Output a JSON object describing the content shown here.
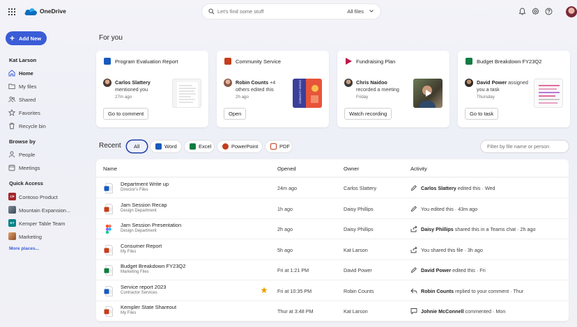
{
  "app": {
    "name": "OneDrive"
  },
  "search": {
    "placeholder": "Let's find some stuff",
    "filter": "All files"
  },
  "sidebar": {
    "new_label": "Add New",
    "user": "Kat Larson",
    "nav": [
      {
        "label": "Home",
        "icon": "home-icon",
        "active": true
      },
      {
        "label": "My files",
        "icon": "folder-icon"
      },
      {
        "label": "Shared",
        "icon": "people-icon"
      },
      {
        "label": "Favorites",
        "icon": "star-icon"
      },
      {
        "label": "Recycle bin",
        "icon": "trash-icon"
      }
    ],
    "browse_by": "Browse by",
    "browse": [
      {
        "label": "People",
        "icon": "person-icon"
      },
      {
        "label": "Meetings",
        "icon": "calendar-icon"
      }
    ],
    "quick_access": "Quick Access",
    "quick": [
      {
        "label": "Contoso Product",
        "badge": "CP",
        "color": "#a4262c"
      },
      {
        "label": "Mountain Expansion...",
        "badge": "",
        "color": "#6b6b6b"
      },
      {
        "label": "Kemper Table Team",
        "badge": "KT",
        "color": "#038387"
      },
      {
        "label": "Marketing",
        "badge": "",
        "color": "#c47a4a"
      }
    ],
    "more_places": "More places..."
  },
  "for_you": {
    "heading": "For you",
    "cards": [
      {
        "title": "Program Evaluation Report",
        "app": "word",
        "person": "Carlos Slattery",
        "action": "mentioned you",
        "time": "27m ago",
        "button": "Go to comment"
      },
      {
        "title": "Community Service",
        "app": "powerpoint",
        "person": "Robin Counts",
        "person_extra": " +4",
        "action": "others edited this",
        "time": "2h ago",
        "button": "Open",
        "thumb_text": "COMMUNITY SERVICE"
      },
      {
        "title": "Fundraising Plan",
        "app": "stream",
        "person": "Chris Naidoo",
        "action": "recorded a meeting",
        "time": "Friday",
        "button": "Watch recording"
      },
      {
        "title": "Budget Breakdown FY23Q2",
        "app": "excel",
        "person": "David Power",
        "action": "assigned you a task",
        "time": "Thursday",
        "button": "Go to task"
      }
    ]
  },
  "recent": {
    "heading": "Recent",
    "chips": [
      "All",
      "Word",
      "Excel",
      "PowerPoint",
      "PDF"
    ],
    "filter_placeholder": "Filter by file name or person",
    "columns": [
      "Name",
      "Opened",
      "Owner",
      "Activity"
    ],
    "rows": [
      {
        "name": "Department Write up",
        "location": "Director's Files",
        "type": "word",
        "opened": "24m ago",
        "owner": "Carlos Slattery",
        "activity_icon": "pencil-icon",
        "actor": "Carlos Slattery",
        "activity": " edited this · Wed",
        "starred": false
      },
      {
        "name": "Jam Session Recap",
        "location": "Design Department",
        "type": "powerpoint",
        "opened": "1h ago",
        "owner": "Daisy Phillips",
        "activity_icon": "pencil-icon",
        "actor": "",
        "activity": "You edited this · 43m ago",
        "starred": false
      },
      {
        "name": "Jam Session Presentation",
        "location": "Design Department",
        "type": "figma",
        "opened": "2h ago",
        "owner": "Daisy Phillips",
        "activity_icon": "share-icon",
        "actor": "Daisy Phillips",
        "activity": " shared this in a Teams chat · 2h ago",
        "starred": false
      },
      {
        "name": "Consumer Report",
        "location": "My Files",
        "type": "powerpoint",
        "opened": "5h ago",
        "owner": "Kat Larson",
        "activity_icon": "share-icon",
        "actor": "",
        "activity": "You shared this file · 3h ago",
        "starred": false
      },
      {
        "name": "Budget Breakdown FY23Q2",
        "location": "Marketing Files",
        "type": "excel",
        "opened": "Fri at 1:21 PM",
        "owner": "David Power",
        "activity_icon": "pencil-icon",
        "actor": "David Power",
        "activity": " edited this · Fri",
        "starred": false
      },
      {
        "name": "Service report 2023",
        "location": "Contractor Services",
        "type": "word",
        "opened": "Fri at 10:35 PM",
        "owner": "Robin Counts",
        "activity_icon": "reply-icon",
        "actor": "Robin Counts",
        "activity": " replied to your comment · Thur",
        "starred": true
      },
      {
        "name": "Kempler State Shareout",
        "location": "My Files",
        "type": "powerpoint",
        "opened": "Thur at 3:48 PM",
        "owner": "Kat Larson",
        "activity_icon": "comment-icon",
        "actor": "Johnie McConnell",
        "activity": " commented · Mon",
        "starred": false
      }
    ]
  },
  "colors": {
    "accent": "#3a5cd6",
    "word": "#185abd",
    "excel": "#107c41",
    "powerpoint": "#c43e1c",
    "stream": "#bc1948"
  }
}
